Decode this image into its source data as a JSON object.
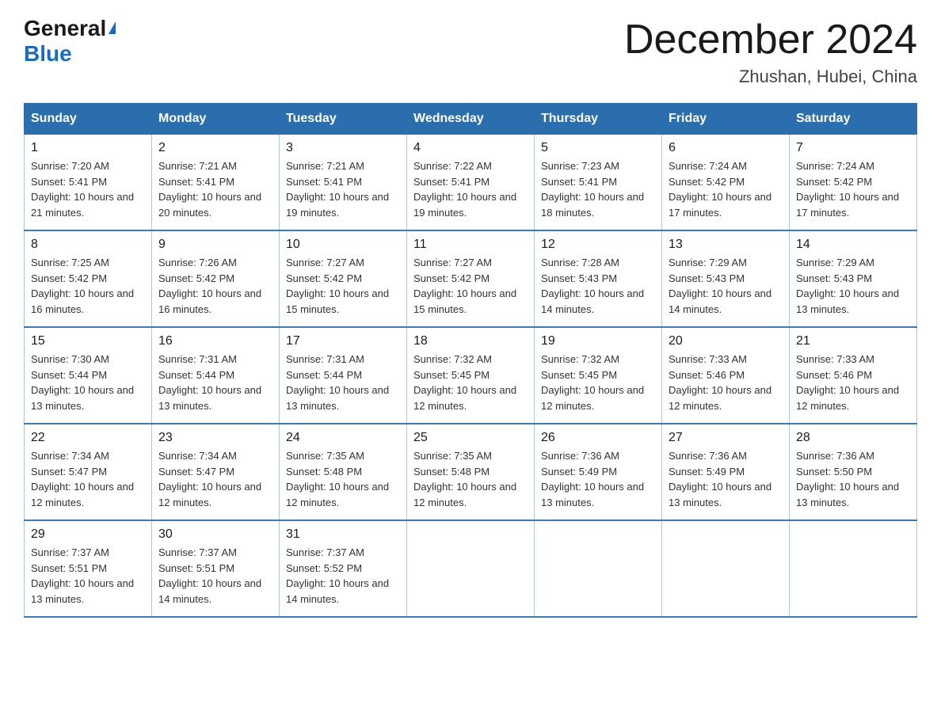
{
  "logo": {
    "general": "General",
    "blue": "Blue",
    "triangle": "▶"
  },
  "title": "December 2024",
  "subtitle": "Zhushan, Hubei, China",
  "days_of_week": [
    "Sunday",
    "Monday",
    "Tuesday",
    "Wednesday",
    "Thursday",
    "Friday",
    "Saturday"
  ],
  "weeks": [
    [
      {
        "day": "1",
        "sunrise": "7:20 AM",
        "sunset": "5:41 PM",
        "daylight": "10 hours and 21 minutes."
      },
      {
        "day": "2",
        "sunrise": "7:21 AM",
        "sunset": "5:41 PM",
        "daylight": "10 hours and 20 minutes."
      },
      {
        "day": "3",
        "sunrise": "7:21 AM",
        "sunset": "5:41 PM",
        "daylight": "10 hours and 19 minutes."
      },
      {
        "day": "4",
        "sunrise": "7:22 AM",
        "sunset": "5:41 PM",
        "daylight": "10 hours and 19 minutes."
      },
      {
        "day": "5",
        "sunrise": "7:23 AM",
        "sunset": "5:41 PM",
        "daylight": "10 hours and 18 minutes."
      },
      {
        "day": "6",
        "sunrise": "7:24 AM",
        "sunset": "5:42 PM",
        "daylight": "10 hours and 17 minutes."
      },
      {
        "day": "7",
        "sunrise": "7:24 AM",
        "sunset": "5:42 PM",
        "daylight": "10 hours and 17 minutes."
      }
    ],
    [
      {
        "day": "8",
        "sunrise": "7:25 AM",
        "sunset": "5:42 PM",
        "daylight": "10 hours and 16 minutes."
      },
      {
        "day": "9",
        "sunrise": "7:26 AM",
        "sunset": "5:42 PM",
        "daylight": "10 hours and 16 minutes."
      },
      {
        "day": "10",
        "sunrise": "7:27 AM",
        "sunset": "5:42 PM",
        "daylight": "10 hours and 15 minutes."
      },
      {
        "day": "11",
        "sunrise": "7:27 AM",
        "sunset": "5:42 PM",
        "daylight": "10 hours and 15 minutes."
      },
      {
        "day": "12",
        "sunrise": "7:28 AM",
        "sunset": "5:43 PM",
        "daylight": "10 hours and 14 minutes."
      },
      {
        "day": "13",
        "sunrise": "7:29 AM",
        "sunset": "5:43 PM",
        "daylight": "10 hours and 14 minutes."
      },
      {
        "day": "14",
        "sunrise": "7:29 AM",
        "sunset": "5:43 PM",
        "daylight": "10 hours and 13 minutes."
      }
    ],
    [
      {
        "day": "15",
        "sunrise": "7:30 AM",
        "sunset": "5:44 PM",
        "daylight": "10 hours and 13 minutes."
      },
      {
        "day": "16",
        "sunrise": "7:31 AM",
        "sunset": "5:44 PM",
        "daylight": "10 hours and 13 minutes."
      },
      {
        "day": "17",
        "sunrise": "7:31 AM",
        "sunset": "5:44 PM",
        "daylight": "10 hours and 13 minutes."
      },
      {
        "day": "18",
        "sunrise": "7:32 AM",
        "sunset": "5:45 PM",
        "daylight": "10 hours and 12 minutes."
      },
      {
        "day": "19",
        "sunrise": "7:32 AM",
        "sunset": "5:45 PM",
        "daylight": "10 hours and 12 minutes."
      },
      {
        "day": "20",
        "sunrise": "7:33 AM",
        "sunset": "5:46 PM",
        "daylight": "10 hours and 12 minutes."
      },
      {
        "day": "21",
        "sunrise": "7:33 AM",
        "sunset": "5:46 PM",
        "daylight": "10 hours and 12 minutes."
      }
    ],
    [
      {
        "day": "22",
        "sunrise": "7:34 AM",
        "sunset": "5:47 PM",
        "daylight": "10 hours and 12 minutes."
      },
      {
        "day": "23",
        "sunrise": "7:34 AM",
        "sunset": "5:47 PM",
        "daylight": "10 hours and 12 minutes."
      },
      {
        "day": "24",
        "sunrise": "7:35 AM",
        "sunset": "5:48 PM",
        "daylight": "10 hours and 12 minutes."
      },
      {
        "day": "25",
        "sunrise": "7:35 AM",
        "sunset": "5:48 PM",
        "daylight": "10 hours and 12 minutes."
      },
      {
        "day": "26",
        "sunrise": "7:36 AM",
        "sunset": "5:49 PM",
        "daylight": "10 hours and 13 minutes."
      },
      {
        "day": "27",
        "sunrise": "7:36 AM",
        "sunset": "5:49 PM",
        "daylight": "10 hours and 13 minutes."
      },
      {
        "day": "28",
        "sunrise": "7:36 AM",
        "sunset": "5:50 PM",
        "daylight": "10 hours and 13 minutes."
      }
    ],
    [
      {
        "day": "29",
        "sunrise": "7:37 AM",
        "sunset": "5:51 PM",
        "daylight": "10 hours and 13 minutes."
      },
      {
        "day": "30",
        "sunrise": "7:37 AM",
        "sunset": "5:51 PM",
        "daylight": "10 hours and 14 minutes."
      },
      {
        "day": "31",
        "sunrise": "7:37 AM",
        "sunset": "5:52 PM",
        "daylight": "10 hours and 14 minutes."
      },
      null,
      null,
      null,
      null
    ]
  ]
}
